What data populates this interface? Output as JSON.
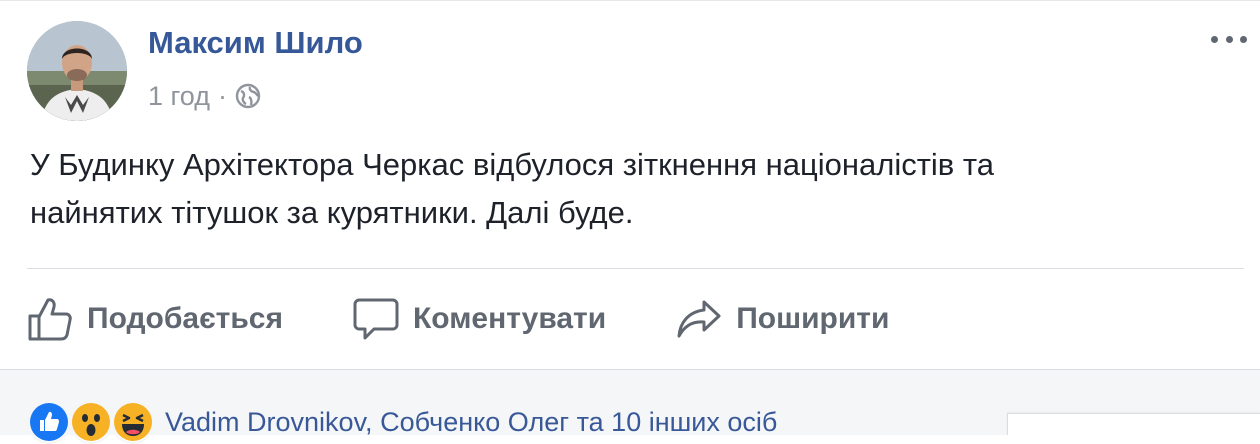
{
  "post": {
    "author": "Максим Шило",
    "timestamp": "1 год",
    "separator": "·",
    "privacy_icon": "globe-icon",
    "more_icon": "more-options-icon",
    "text_line1": "У Будинку Архітектора Черкас відбулося зіткнення націоналістів та",
    "text_line2": "найнятих тітушок за курятники. Далі буде."
  },
  "actions": {
    "like_label": "Подобається",
    "like_icon": "thumbs-up-icon",
    "comment_label": "Коментувати",
    "comment_icon": "speech-bubble-icon",
    "share_label": "Поширити",
    "share_icon": "share-arrow-icon"
  },
  "reactions": {
    "icons": [
      "like-reaction-icon",
      "wow-reaction-icon",
      "haha-reaction-icon"
    ],
    "summary": "Vadim Drovnikov, Собченко Олег та 10 інших осіб"
  },
  "colors": {
    "author": "#365899",
    "meta": "#90949c",
    "text": "#1d2129",
    "action": "#606770",
    "reaction_link": "#385898",
    "like_blue": "#1877f2",
    "emoji_yellow": "#f7b125",
    "footer_bg": "#f5f6f7"
  }
}
